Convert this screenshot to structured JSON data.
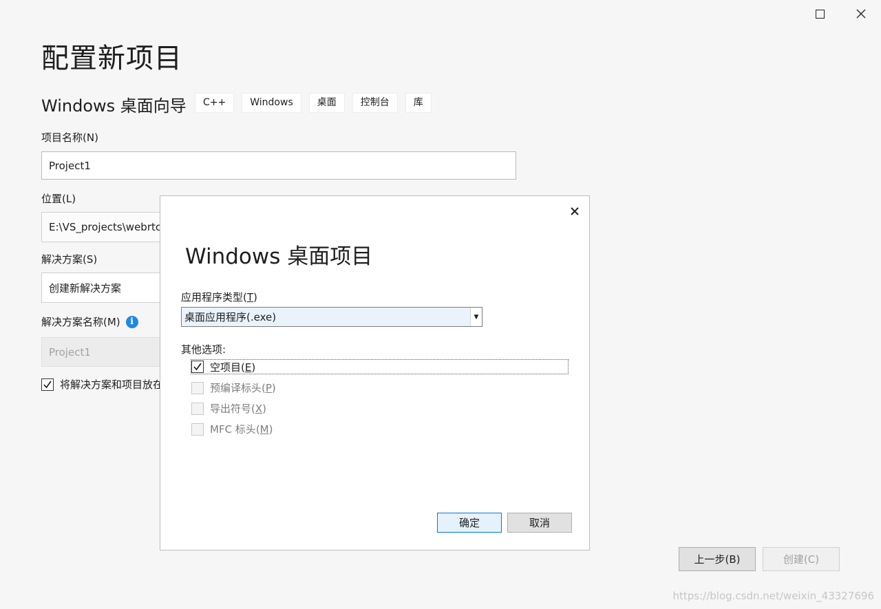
{
  "window": {
    "maximize_icon": "maximize-icon",
    "close_icon": "close-icon"
  },
  "page": {
    "title": "配置新项目",
    "template_name": "Windows 桌面向导",
    "tags": [
      "C++",
      "Windows",
      "桌面",
      "控制台",
      "库"
    ]
  },
  "form": {
    "project_name_label": "项目名称(N)",
    "project_name_value": "Project1",
    "location_label": "位置(L)",
    "location_value": "E:\\VS_projects\\webrtc",
    "solution_label": "解决方案(S)",
    "solution_value": "创建新解决方案",
    "solution_name_label": "解决方案名称(M)",
    "solution_name_value": "Project1",
    "same_dir_checkbox_label": "将解决方案和项目放在同一目录中",
    "same_dir_checked": true
  },
  "footer": {
    "back_label": "上一步(B)",
    "create_label": "创建(C)"
  },
  "dialog": {
    "title": "Windows 桌面项目",
    "app_type_label": "应用程序类型",
    "app_type_key": "T",
    "app_type_value": "桌面应用程序(.exe)",
    "other_options_label": "其他选项:",
    "options": [
      {
        "text": "空项目",
        "key": "E",
        "checked": true,
        "enabled": true
      },
      {
        "text": "预编译标头",
        "key": "P",
        "checked": false,
        "enabled": false
      },
      {
        "text": "导出符号",
        "key": "X",
        "checked": false,
        "enabled": false
      },
      {
        "text": "MFC 标头",
        "key": "M",
        "checked": false,
        "enabled": false
      }
    ],
    "ok_label": "确定",
    "cancel_label": "取消"
  },
  "watermark": "https://blog.csdn.net/weixin_43327696",
  "colors": {
    "background": "#f6f6f6",
    "info_icon": "#1e88e5",
    "primary_border": "#0078d7"
  }
}
